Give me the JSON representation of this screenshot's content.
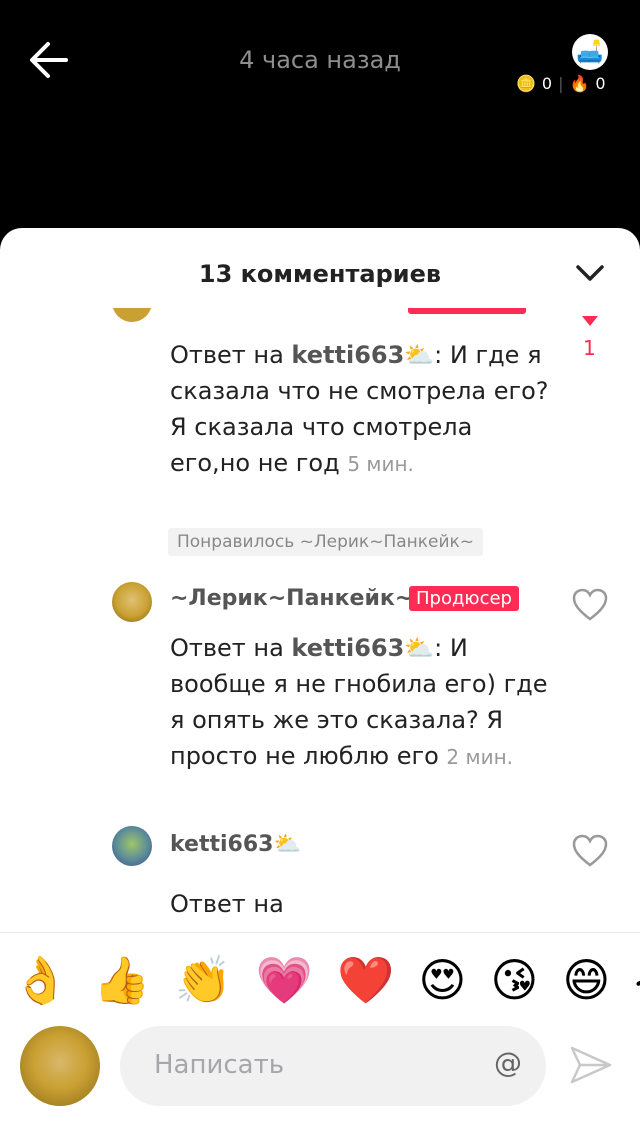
{
  "header": {
    "time_ago": "4 часа назад",
    "coins": "0",
    "fire": "0"
  },
  "sheet": {
    "title": "13 комментариев"
  },
  "comments": [
    {
      "reply_prefix": "Ответ на ",
      "reply_to": "ketti663⛅",
      "text": ": И где я сказала что не смотрела его? Я сказала что смотрела его,но не год",
      "time": "5 мин.",
      "liked_by": "Понравилось ~Лерик~Панкейк~",
      "likes": "1"
    },
    {
      "author": "~Лерик~Панкейк~",
      "badge": "Продюсер",
      "reply_prefix": "Ответ на ",
      "reply_to": "ketti663⛅",
      "text": ": И вообще я не гнобила его) где я опять же это сказала? Я просто не люблю его",
      "time": "2 мин."
    },
    {
      "author": "ketti663⛅",
      "text": "Ответ на"
    }
  ],
  "emojis": [
    "👌",
    "👍",
    "👏",
    "💗",
    "❤️",
    "😍",
    "😘",
    "😄",
    "😂"
  ],
  "composer": {
    "placeholder": "Написать",
    "at": "@"
  },
  "colors": {
    "accent": "#fe2c55"
  }
}
